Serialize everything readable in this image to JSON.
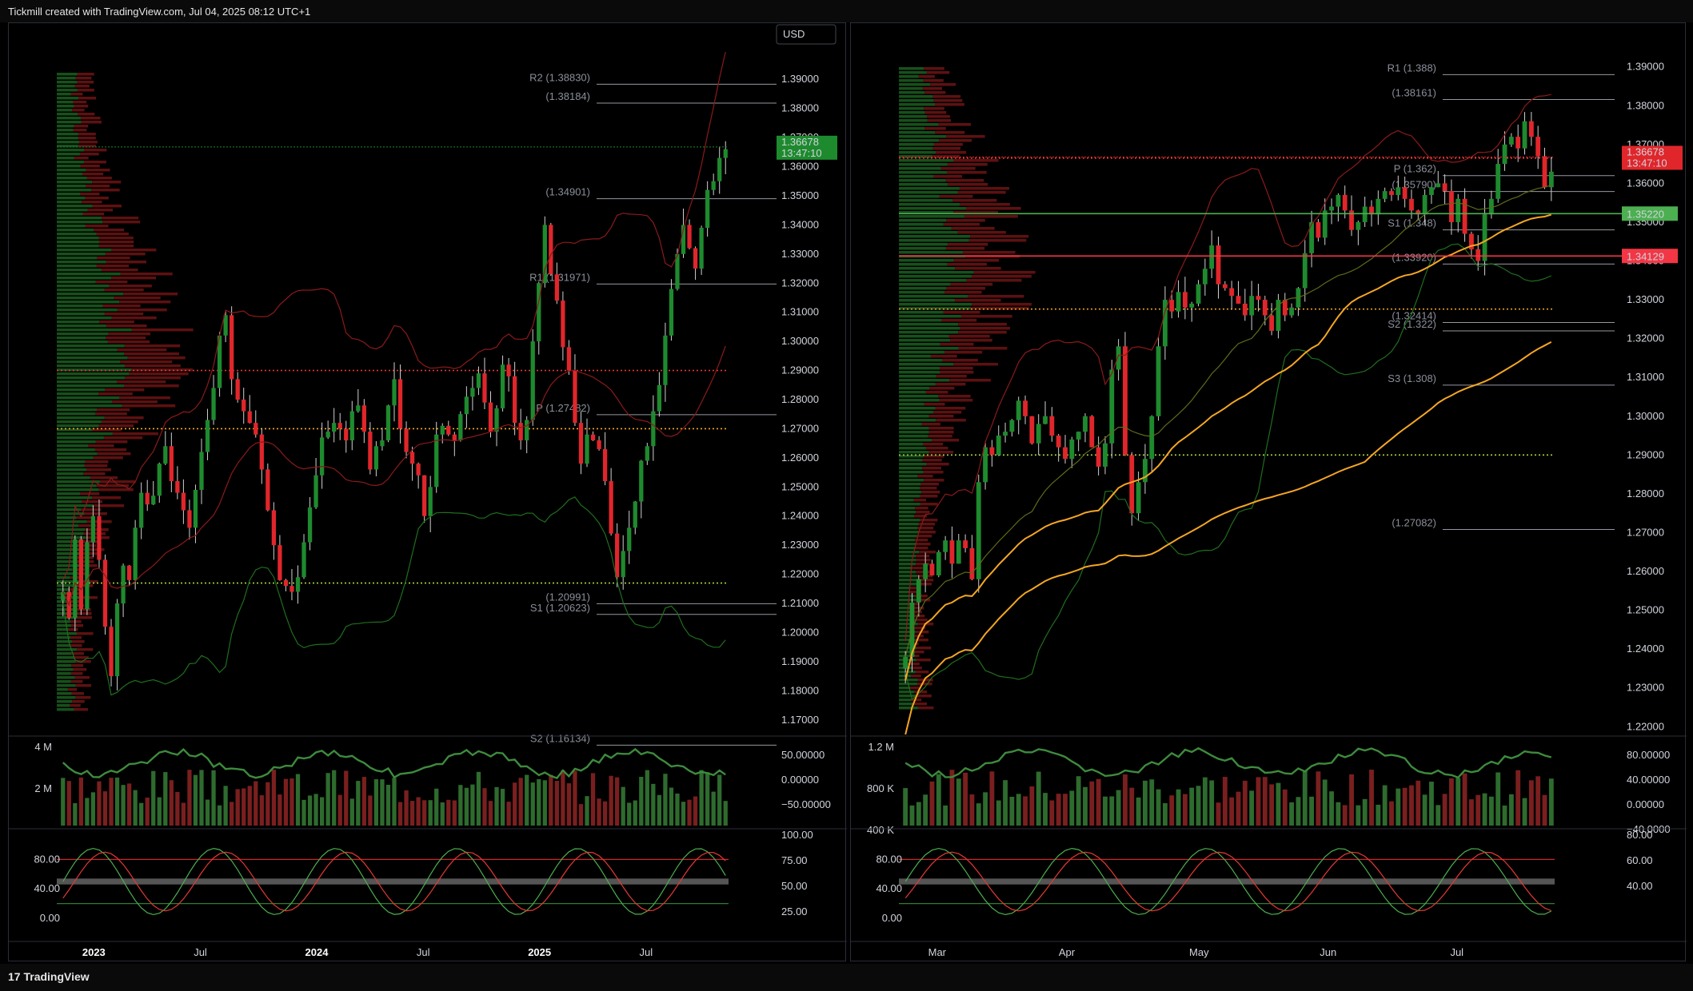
{
  "header": {
    "title": "Tickmill created with TradingView.com, Jul 04, 2025 08:12 UTC+1"
  },
  "footer": {
    "brand": "TradingView"
  },
  "colors": {
    "up": "#1e8a2e",
    "down": "#e0262b",
    "bb": "#8b1a1a",
    "bb_low": "#1f6e1f",
    "ma": "#f5a623",
    "grid": "#2a2e39"
  },
  "chart_data": [
    {
      "type": "candlestick",
      "timeframe": "weekly",
      "currency_label": "USD",
      "y_ticks": [
        "1.39000",
        "1.38000",
        "1.37000",
        "1.36000",
        "1.35000",
        "1.34000",
        "1.33000",
        "1.32000",
        "1.31000",
        "1.30000",
        "1.29000",
        "1.28000",
        "1.27000",
        "1.26000",
        "1.25000",
        "1.24000",
        "1.23000",
        "1.22000",
        "1.21000",
        "1.20000",
        "1.19000",
        "1.18000",
        "1.17000"
      ],
      "ylim": [
        1.165,
        1.395
      ],
      "x_labels": [
        "2023",
        "Jul",
        "2024",
        "Jul",
        "2025",
        "Jul"
      ],
      "x_bold": [
        "2023",
        "2024",
        "2025"
      ],
      "last_price": "1.36678",
      "countdown": "13:47:10",
      "levels": [
        {
          "label": "R2 (1.38830)",
          "value": 1.3883
        },
        {
          "label": "(1.38184)",
          "value": 1.38184
        },
        {
          "label": "(1.34901)",
          "value": 1.34901
        },
        {
          "label": "R1 (1.31971)",
          "value": 1.31971
        },
        {
          "label": "P (1.27482)",
          "value": 1.27482
        },
        {
          "label": "(1.20991)",
          "value": 1.20991
        },
        {
          "label": "S1 (1.20623)",
          "value": 1.20623
        },
        {
          "label": "S2 (1.16134)",
          "value": 1.16134
        }
      ],
      "close_series": [
        1.214,
        1.205,
        1.232,
        1.208,
        1.231,
        1.24,
        1.225,
        1.202,
        1.185,
        1.21,
        1.223,
        1.218,
        1.236,
        1.248,
        1.244,
        1.247,
        1.258,
        1.264,
        1.252,
        1.248,
        1.242,
        1.236,
        1.249,
        1.262,
        1.273,
        1.284,
        1.302,
        1.309,
        1.287,
        1.28,
        1.276,
        1.272,
        1.268,
        1.256,
        1.242,
        1.23,
        1.218,
        1.216,
        1.214,
        1.219,
        1.231,
        1.243,
        1.254,
        1.267,
        1.269,
        1.272,
        1.27,
        1.266,
        1.276,
        1.278,
        1.269,
        1.256,
        1.264,
        1.266,
        1.278,
        1.287,
        1.27,
        1.262,
        1.258,
        1.254,
        1.24,
        1.25,
        1.268,
        1.271,
        1.268,
        1.266,
        1.275,
        1.281,
        1.284,
        1.289,
        1.279,
        1.269,
        1.277,
        1.292,
        1.288,
        1.272,
        1.266,
        1.273,
        1.3,
        1.32,
        1.34,
        1.323,
        1.314,
        1.298,
        1.29,
        1.272,
        1.258,
        1.268,
        1.266,
        1.263,
        1.252,
        1.234,
        1.219,
        1.228,
        1.236,
        1.245,
        1.259,
        1.264,
        1.276,
        1.285,
        1.302,
        1.318,
        1.33,
        1.34,
        1.332,
        1.325,
        1.339,
        1.352,
        1.355,
        1.363,
        1.366
      ]
    },
    {
      "type": "candlestick",
      "timeframe": "daily",
      "y_ticks": [
        "1.39000",
        "1.38000",
        "1.37000",
        "1.36000",
        "1.35000",
        "1.34000",
        "1.33000",
        "1.32000",
        "1.31000",
        "1.30000",
        "1.29000",
        "1.28000",
        "1.27000",
        "1.26000",
        "1.25000",
        "1.24000",
        "1.23000",
        "1.22000"
      ],
      "ylim": [
        1.218,
        1.392
      ],
      "x_labels": [
        "Mar",
        "Apr",
        "May",
        "Jun",
        "Jul"
      ],
      "last_price": "1.36678",
      "countdown": "13:47:10",
      "tags": [
        {
          "label": "1.35220",
          "value": 1.3522,
          "color": "#4caf50"
        },
        {
          "label": "1.34129",
          "value": 1.34129,
          "color": "#f23645"
        }
      ],
      "levels": [
        {
          "label": "(1.38161)",
          "value": 1.38161
        },
        {
          "label": "R1 (1.388)",
          "value": 1.388
        },
        {
          "label": "(1.35790)",
          "value": 1.3579
        },
        {
          "label": "P (1.362)",
          "value": 1.362
        },
        {
          "label": "S1 (1.348)",
          "value": 1.348
        },
        {
          "label": "(1.33920)",
          "value": 1.3392
        },
        {
          "label": "(1.32414)",
          "value": 1.32414
        },
        {
          "label": "S2 (1.322)",
          "value": 1.322
        },
        {
          "label": "S3 (1.308)",
          "value": 1.308
        },
        {
          "label": "(1.27082)",
          "value": 1.27082
        }
      ],
      "close_series": [
        1.238,
        1.252,
        1.258,
        1.262,
        1.259,
        1.265,
        1.268,
        1.262,
        1.268,
        1.266,
        1.258,
        1.283,
        1.292,
        1.29,
        1.295,
        1.296,
        1.299,
        1.304,
        1.3,
        1.293,
        1.298,
        1.3,
        1.295,
        1.292,
        1.289,
        1.294,
        1.296,
        1.3,
        1.292,
        1.287,
        1.293,
        1.312,
        1.318,
        1.29,
        1.275,
        1.283,
        1.289,
        1.3,
        1.318,
        1.33,
        1.327,
        1.332,
        1.328,
        1.329,
        1.334,
        1.338,
        1.344,
        1.334,
        1.333,
        1.331,
        1.329,
        1.326,
        1.331,
        1.33,
        1.326,
        1.322,
        1.33,
        1.326,
        1.328,
        1.333,
        1.342,
        1.35,
        1.346,
        1.353,
        1.354,
        1.357,
        1.353,
        1.348,
        1.35,
        1.354,
        1.352,
        1.356,
        1.358,
        1.357,
        1.359,
        1.356,
        1.353,
        1.352,
        1.357,
        1.359,
        1.36,
        1.358,
        1.35,
        1.356,
        1.347,
        1.343,
        1.34,
        1.352,
        1.356,
        1.365,
        1.37,
        1.372,
        1.369,
        1.376,
        1.372,
        1.367,
        1.359,
        1.363
      ]
    }
  ],
  "indicators": {
    "left_volume_ticks": [
      "4 M",
      "2 M"
    ],
    "left_osc_ticks": [
      "50.00000",
      "0.00000",
      "−50.00000"
    ],
    "left_stoch_ticks": [
      "80.00",
      "40.00",
      "0.00"
    ],
    "left_stoch_right_ticks": [
      "100.00",
      "75.00",
      "50.00",
      "25.00"
    ],
    "right_volume_ticks": [
      "1.2 M",
      "800 K",
      "400 K"
    ],
    "right_osc_ticks": [
      "80.00000",
      "40.00000",
      "0.00000",
      "−40.0000"
    ],
    "right_stoch_ticks": [
      "80.00",
      "40.00",
      "0.00"
    ],
    "right_stoch_right_ticks": [
      "80.00",
      "60.00",
      "40.00"
    ]
  }
}
